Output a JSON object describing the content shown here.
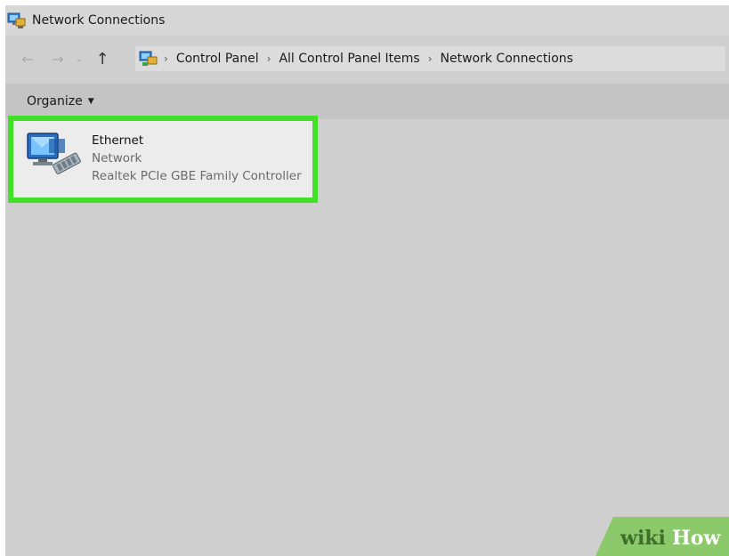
{
  "window": {
    "title": "Network Connections",
    "app_icon": "network-connections-icon"
  },
  "nav": {
    "back_icon": "back-arrow-icon",
    "forward_icon": "forward-arrow-icon",
    "recent_icon": "recent-locations-chevron-icon",
    "up_icon": "up-arrow-icon",
    "breadcrumbs": [
      {
        "label": "Control Panel"
      },
      {
        "label": "All Control Panel Items"
      },
      {
        "label": "Network Connections"
      }
    ],
    "separator": "›"
  },
  "toolbar": {
    "organize_label": "Organize",
    "organize_icon": "chevron-down-icon"
  },
  "connections": [
    {
      "name": "Ethernet",
      "network": "Network",
      "device": "Realtek PCIe GBE Family Controller",
      "icon": "ethernet-adapter-icon",
      "highlight_color": "#43e02a"
    }
  ],
  "watermark": {
    "brand_left": "wiki",
    "brand_right": "How",
    "color": "#8cc96a"
  },
  "colors": {
    "window_bg": "#cfcfcf",
    "command_bar_bg": "#c4c4c4",
    "highlight": "#43e02a"
  }
}
